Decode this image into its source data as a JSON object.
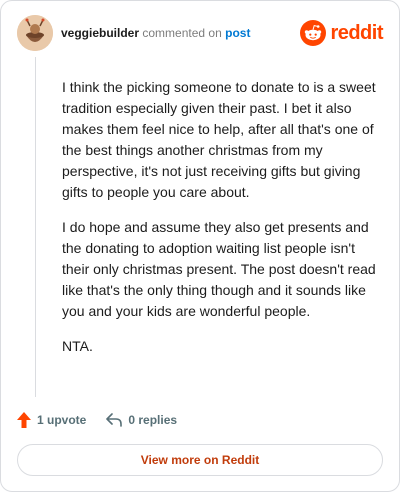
{
  "header": {
    "username": "veggiebuilder",
    "action_text": "commented on",
    "post_link": "post",
    "brand": "reddit"
  },
  "comment": {
    "paragraphs": [
      "I think the picking someone to donate to is a sweet tradition especially given their past. I bet it also makes them feel nice to help, after all that's one of the best things another christmas from my perspective, it's not just receiving gifts but giving gifts to people you care about.",
      "I do hope and assume they also get presents and the donating to adoption waiting list people isn't their only christmas present. The post doesn't read like that's the only thing though and it sounds like you and your kids are wonderful people.",
      "NTA."
    ]
  },
  "actions": {
    "upvote_label": "1 upvote",
    "replies_label": "0 replies"
  },
  "footer": {
    "view_more_label": "View more on Reddit"
  },
  "colors": {
    "brand": "#ff4500",
    "link": "#0079d3",
    "view_more": "#c13c0b",
    "muted": "#576f76"
  },
  "icons": {
    "upvote": "upvote-arrow-icon",
    "reply": "reply-arrow-icon",
    "brand": "reddit-snoo-icon"
  }
}
